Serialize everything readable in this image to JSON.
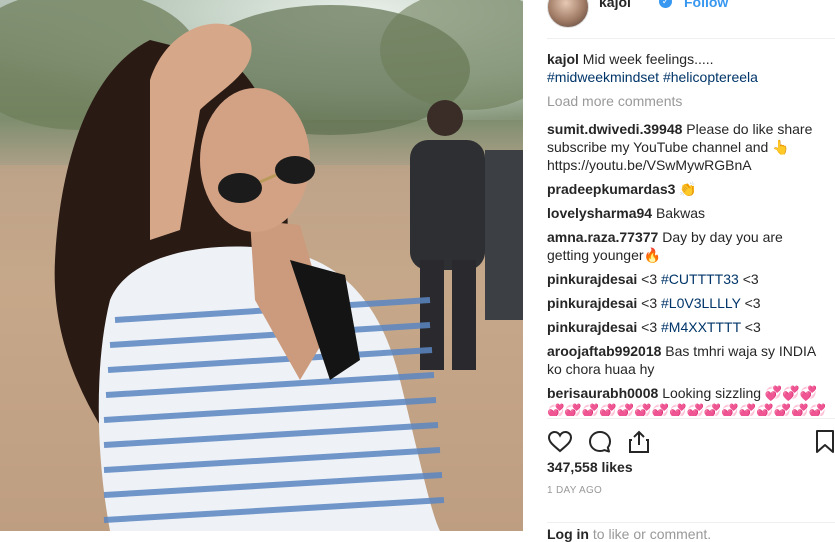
{
  "post": {
    "username": "kajol",
    "follow_label": "Follow",
    "caption_user": "kajol",
    "caption_text": "Mid week feelings.....",
    "caption_tag1": "#midweekmindset",
    "caption_tag2": "#helicoptereela",
    "load_more": "Load more comments"
  },
  "comments": [
    {
      "user": "sumit.dwivedi.39948",
      "text": "Please do like share subscribe my YouTube channel and 👆 https://youtu.be/VSwMywRGBnA"
    },
    {
      "user": "pradeepkumardas3",
      "text": "👏"
    },
    {
      "user": "lovelysharma94",
      "text": "Bakwas"
    },
    {
      "user": "amna.raza.77377",
      "text": "Day by day you are getting younger🔥"
    },
    {
      "user": "pinkurajdesai",
      "pre": "<3",
      "tag": "#CUTTTT33",
      "post": "<3"
    },
    {
      "user": "pinkurajdesai",
      "pre": "<3",
      "tag": "#L0V3LLLLY",
      "post": "<3"
    },
    {
      "user": "pinkurajdesai",
      "pre": "<3",
      "tag": "#M4XXTTTT",
      "post": "<3"
    },
    {
      "user": "aroojaftab992018",
      "text": "Bas tmhri waja sy INDIA ko chora huaa hy"
    },
    {
      "user": "berisaurabh0008",
      "text": "Looking sizzling 💞💞💞💞💞💞💞💞💞💞💞💞💞💞💞💞💞💞💞"
    }
  ],
  "stats": {
    "likes": "347,558 likes",
    "time": "1 DAY AGO"
  },
  "login": {
    "link": "Log in",
    "rest": " to like or comment."
  },
  "icons": [
    "heart-icon",
    "comment-icon",
    "share-icon",
    "bookmark-icon",
    "verified-icon"
  ],
  "colors": {
    "link": "#003569",
    "accent": "#3897f0",
    "muted": "#999999"
  }
}
